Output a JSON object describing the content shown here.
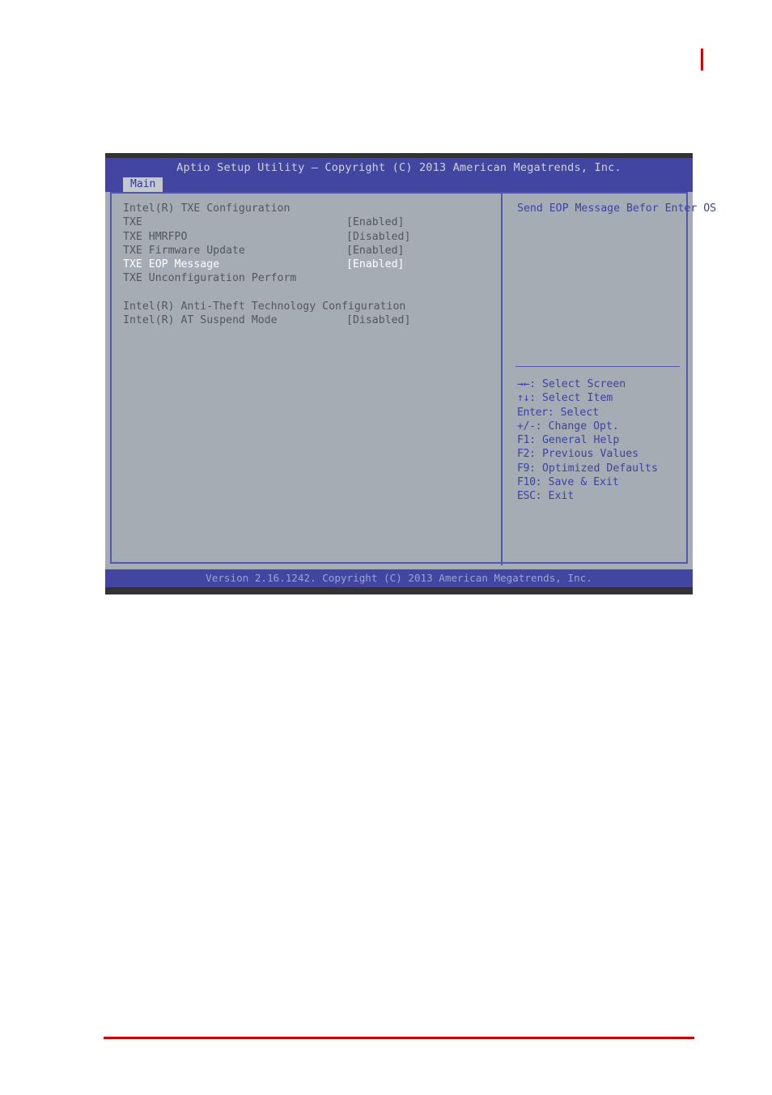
{
  "page": {
    "red_accent_color": "#cc0000",
    "background_color": "#ffffff"
  },
  "bios": {
    "title": "Aptio Setup Utility – Copyright (C) 2013 American Megatrends, Inc.",
    "footer": "Version 2.16.1242. Copyright (C) 2013 American Megatrends, Inc.",
    "colors": {
      "titlebar": "#4246a0",
      "screen": "#a6acb4",
      "border": "#4f58b0",
      "text": "#53575e",
      "selected_text": "#ffffff",
      "help_text": "#3b44a6",
      "tab_active_bg": "#c3c7ce",
      "tab_active_text": "#34398f"
    },
    "tabs": [
      {
        "label": "Main",
        "active": true
      }
    ],
    "settings": [
      {
        "label": "Intel(R) TXE Configuration",
        "value": "",
        "selected": false,
        "spacer": false
      },
      {
        "label": "TXE",
        "value": "[Enabled]",
        "selected": false,
        "spacer": false
      },
      {
        "label": "TXE HMRFPO",
        "value": "[Disabled]",
        "selected": false,
        "spacer": false
      },
      {
        "label": "TXE Firmware Update",
        "value": "[Enabled]",
        "selected": false,
        "spacer": false
      },
      {
        "label": "TXE EOP Message",
        "value": "[Enabled]",
        "selected": true,
        "spacer": false
      },
      {
        "label": "TXE Unconfiguration Perform",
        "value": "",
        "selected": false,
        "spacer": false
      },
      {
        "label": "",
        "value": "",
        "selected": false,
        "spacer": true
      },
      {
        "label": "Intel(R) Anti-Theft Technology Configuration",
        "value": "",
        "selected": false,
        "spacer": false
      },
      {
        "label": "Intel(R) AT Suspend Mode",
        "value": "[Disabled]",
        "selected": false,
        "spacer": false
      }
    ],
    "help": {
      "text": "Send EOP Message Befor Enter OS"
    },
    "key_legend": [
      {
        "keys": "→←",
        "separator": ": ",
        "action": "Select Screen"
      },
      {
        "keys": "↑↓",
        "separator": ": ",
        "action": "Select Item"
      },
      {
        "keys": "Enter",
        "separator": ": ",
        "action": "Select"
      },
      {
        "keys": "+/-",
        "separator": ": ",
        "action": "Change Opt."
      },
      {
        "keys": "F1",
        "separator": ": ",
        "action": "General Help"
      },
      {
        "keys": "F2",
        "separator": ": ",
        "action": "Previous Values"
      },
      {
        "keys": "F9",
        "separator": ": ",
        "action": "Optimized Defaults"
      },
      {
        "keys": "F10",
        "separator": ": ",
        "action": "Save & Exit"
      },
      {
        "keys": "ESC",
        "separator": ": ",
        "action": "Exit"
      }
    ]
  }
}
